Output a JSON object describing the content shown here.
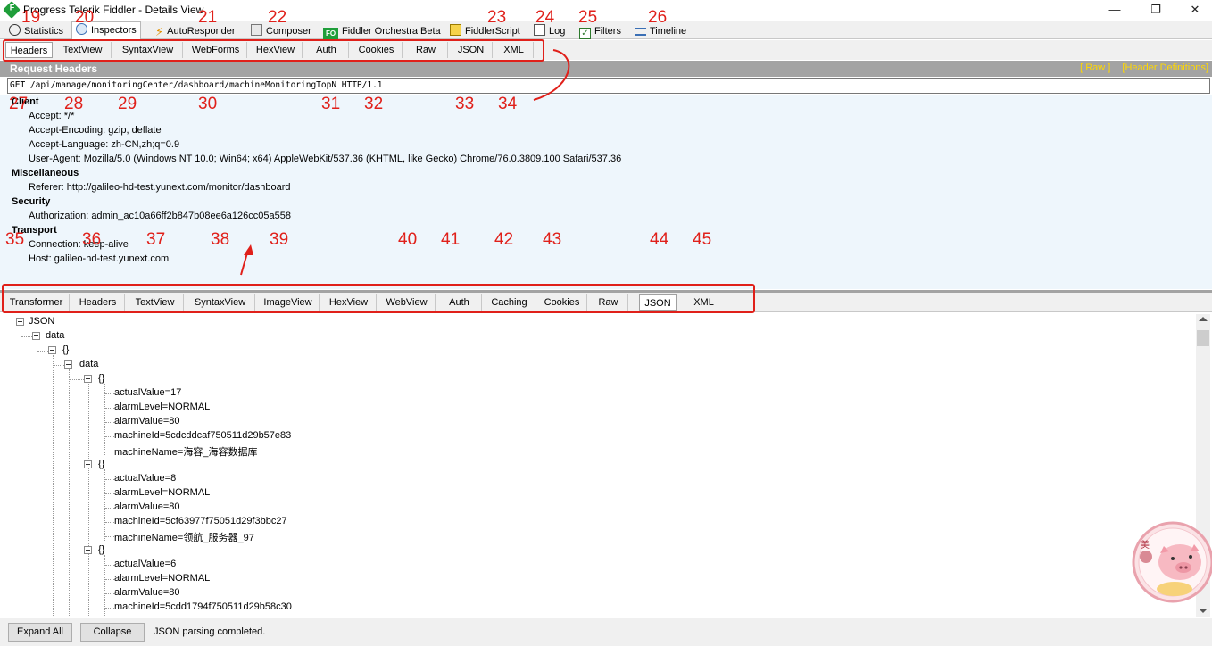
{
  "window": {
    "title": "Progress Telerik Fiddler - Details View",
    "min_glyph": "—",
    "max_glyph": "❐",
    "close_glyph": "✕"
  },
  "main_tabs": [
    {
      "label": "Statistics",
      "icon": "stopwatch-icon"
    },
    {
      "label": "Inspectors",
      "icon": "magnifier-icon",
      "active": true
    },
    {
      "label": "AutoResponder",
      "icon": "lightning-icon"
    },
    {
      "label": "Composer",
      "icon": "pencil-icon"
    },
    {
      "label": "Fiddler Orchestra Beta",
      "icon": "fo-icon",
      "icon_text": "FO"
    },
    {
      "label": "FiddlerScript",
      "icon": "script-icon"
    },
    {
      "label": "Log",
      "icon": "document-icon"
    },
    {
      "label": "Filters",
      "icon": "checkbox-icon"
    },
    {
      "label": "Timeline",
      "icon": "timeline-icon"
    }
  ],
  "request_tabs": [
    "Headers",
    "TextView",
    "SyntaxView",
    "WebForms",
    "HexView",
    "Auth",
    "Cookies",
    "Raw",
    "JSON",
    "XML"
  ],
  "request_headers": {
    "title": "Request Headers",
    "links": [
      "[ Raw ]",
      "[Header Definitions]"
    ],
    "request_line": "GET /api/manage/monitoringCenter/dashboard/machineMonitoringTopN HTTP/1.1",
    "groups": [
      {
        "name": "Client",
        "lines": [
          "Accept: */*",
          "Accept-Encoding: gzip, deflate",
          "Accept-Language: zh-CN,zh;q=0.9",
          "User-Agent: Mozilla/5.0 (Windows NT 10.0; Win64; x64) AppleWebKit/537.36 (KHTML, like Gecko) Chrome/76.0.3809.100 Safari/537.36"
        ]
      },
      {
        "name": "Miscellaneous",
        "lines": [
          "Referer: http://galileo-hd-test.yunext.com/monitor/dashboard"
        ]
      },
      {
        "name": "Security",
        "lines": [
          "Authorization: admin_ac10a66ff2b847b08ee6a126cc05a558"
        ]
      },
      {
        "name": "Transport",
        "lines": [
          "Connection: keep-alive",
          "Host: galileo-hd-test.yunext.com"
        ]
      }
    ]
  },
  "response_tabs": [
    "Transformer",
    "Headers",
    "TextView",
    "SyntaxView",
    "ImageView",
    "HexView",
    "WebView",
    "Auth",
    "Caching",
    "Cookies",
    "Raw",
    "JSON",
    "XML"
  ],
  "json_tree": {
    "root": "JSON",
    "data_key": "data",
    "object_label": "{}",
    "inner_key": "data",
    "items": [
      [
        "actualValue=17",
        "alarmLevel=NORMAL",
        "alarmValue=80",
        "machineId=5cdcddcaf750511d29b57e83",
        "machineName=海容_海容数据库"
      ],
      [
        "actualValue=8",
        "alarmLevel=NORMAL",
        "alarmValue=80",
        "machineId=5cf63977f75051d29f3bbc27",
        "machineName=领航_服务器_97"
      ],
      [
        "actualValue=6",
        "alarmLevel=NORMAL",
        "alarmValue=80",
        "machineId=5cdd1794f750511d29b58c30"
      ]
    ]
  },
  "bottom": {
    "expand_all": "Expand All",
    "collapse": "Collapse",
    "status": "JSON parsing completed."
  },
  "annotations": {
    "numbers": [
      "19",
      "20",
      "21",
      "22",
      "23",
      "24",
      "25",
      "26",
      "27",
      "28",
      "29",
      "30",
      "31",
      "32",
      "33",
      "34",
      "35",
      "36",
      "37",
      "38",
      "39",
      "40",
      "41",
      "42",
      "43",
      "44",
      "45"
    ],
    "color": "#e0201a"
  },
  "colors": {
    "accent_yellow": "#ffd800",
    "header_bar": "#a3a3a3",
    "headers_pane_bg": "#eef6fc"
  }
}
